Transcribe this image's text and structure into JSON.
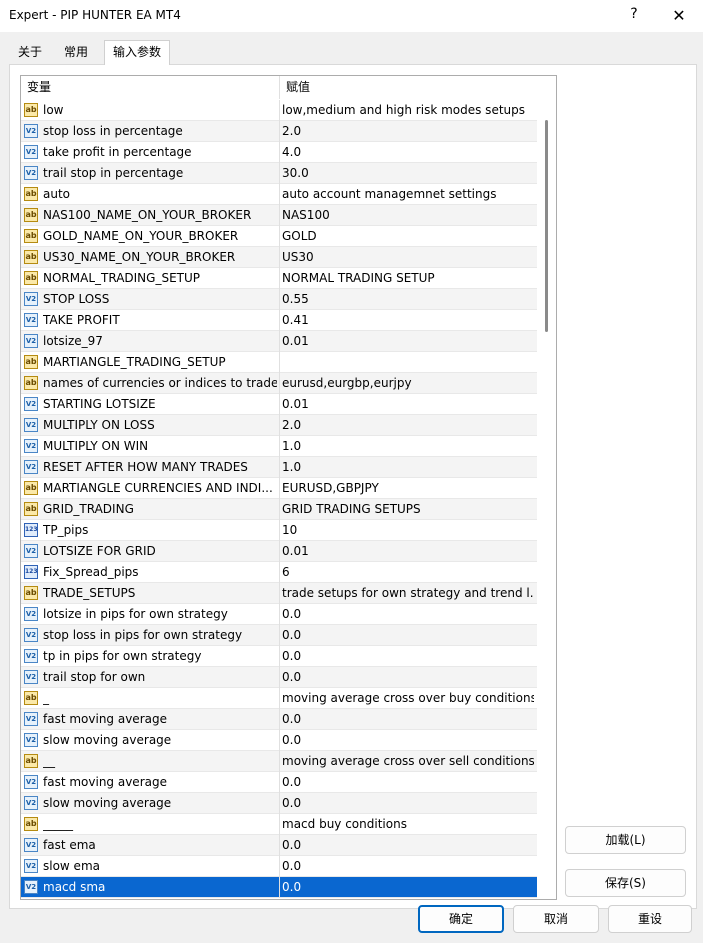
{
  "window": {
    "title": "Expert - PIP HUNTER EA MT4",
    "help_label": "?",
    "close_label": "✕"
  },
  "tabs": [
    {
      "label": "关于",
      "active": false
    },
    {
      "label": "常用",
      "active": false
    },
    {
      "label": "输入参数",
      "active": true
    }
  ],
  "grid": {
    "header_variable": "变量",
    "header_value": "赋值",
    "rows": [
      {
        "type": "ab",
        "name": "low",
        "value": "low,medium and high risk modes setups"
      },
      {
        "type": "dbl",
        "name": "stop loss in percentage",
        "value": "2.0"
      },
      {
        "type": "dbl",
        "name": "take profit in percentage",
        "value": "4.0"
      },
      {
        "type": "dbl",
        "name": "trail stop in percentage",
        "value": "30.0"
      },
      {
        "type": "ab",
        "name": "auto",
        "value": "auto account managemnet settings"
      },
      {
        "type": "ab",
        "name": "NAS100_NAME_ON_YOUR_BROKER",
        "value": "NAS100"
      },
      {
        "type": "ab",
        "name": "GOLD_NAME_ON_YOUR_BROKER",
        "value": "GOLD"
      },
      {
        "type": "ab",
        "name": "US30_NAME_ON_YOUR_BROKER",
        "value": "US30"
      },
      {
        "type": "ab",
        "name": "NORMAL_TRADING_SETUP",
        "value": "NORMAL TRADING SETUP"
      },
      {
        "type": "dbl",
        "name": "STOP LOSS",
        "value": "0.55"
      },
      {
        "type": "dbl",
        "name": "TAKE PROFIT",
        "value": "0.41"
      },
      {
        "type": "dbl",
        "name": "lotsize_97",
        "value": "0.01"
      },
      {
        "type": "ab",
        "name": "MARTIANGLE_TRADING_SETUP",
        "value": ""
      },
      {
        "type": "ab",
        "name": "names of currencies or indices to trade",
        "value": "eurusd,eurgbp,eurjpy"
      },
      {
        "type": "dbl",
        "name": "STARTING LOTSIZE",
        "value": "0.01"
      },
      {
        "type": "dbl",
        "name": "MULTIPLY ON LOSS",
        "value": "2.0"
      },
      {
        "type": "dbl",
        "name": "MULTIPLY ON WIN",
        "value": "1.0"
      },
      {
        "type": "dbl",
        "name": "RESET AFTER HOW MANY TRADES",
        "value": "1.0"
      },
      {
        "type": "ab",
        "name": "MARTIANGLE CURRENCIES AND INDI...",
        "value": "EURUSD,GBPJPY"
      },
      {
        "type": "ab",
        "name": "GRID_TRADING",
        "value": "GRID TRADING SETUPS"
      },
      {
        "type": "int",
        "name": "TP_pips",
        "value": "10"
      },
      {
        "type": "dbl",
        "name": "LOTSIZE FOR GRID",
        "value": "0.01"
      },
      {
        "type": "int",
        "name": "Fix_Spread_pips",
        "value": "6"
      },
      {
        "type": "ab",
        "name": "TRADE_SETUPS",
        "value": "trade setups for own strategy and trend l..."
      },
      {
        "type": "dbl",
        "name": "lotsize in pips for own strategy",
        "value": "0.0"
      },
      {
        "type": "dbl",
        "name": "stop loss in pips for own strategy",
        "value": "0.0"
      },
      {
        "type": "dbl",
        "name": "tp in pips for own strategy",
        "value": "0.0"
      },
      {
        "type": "dbl",
        "name": "trail stop for own",
        "value": "0.0"
      },
      {
        "type": "ab",
        "name": "_",
        "value": "moving average cross over buy conditions"
      },
      {
        "type": "dbl",
        "name": "fast moving average",
        "value": "0.0"
      },
      {
        "type": "dbl",
        "name": "slow moving average",
        "value": "0.0"
      },
      {
        "type": "ab",
        "name": "__",
        "value": "moving average cross over sell conditions"
      },
      {
        "type": "dbl",
        "name": "fast moving average",
        "value": "0.0"
      },
      {
        "type": "dbl",
        "name": "slow moving average",
        "value": "0.0"
      },
      {
        "type": "ab",
        "name": "_____",
        "value": "macd buy conditions"
      },
      {
        "type": "dbl",
        "name": "fast ema",
        "value": "0.0"
      },
      {
        "type": "dbl",
        "name": "slow ema",
        "value": "0.0"
      },
      {
        "type": "dbl",
        "name": "macd sma",
        "value": "0.0",
        "selected": true
      }
    ]
  },
  "icons": {
    "ab": "ab",
    "dbl": "V2",
    "int": "123"
  },
  "buttons": {
    "load": "加载(L)",
    "save": "保存(S)",
    "ok": "确定",
    "cancel": "取消",
    "reset": "重设"
  },
  "colors": {
    "selection": "#0a67d0",
    "accent": "#0067c0"
  }
}
